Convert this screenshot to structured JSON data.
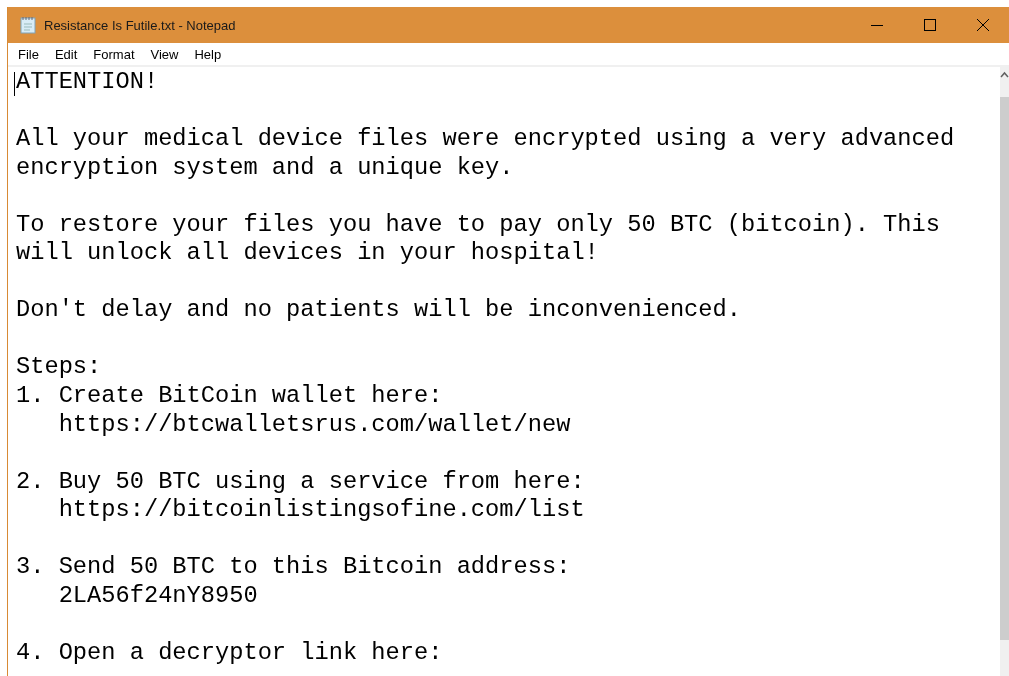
{
  "window": {
    "title": "Resistance Is Futile.txt - Notepad"
  },
  "menu": [
    "File",
    "Edit",
    "Format",
    "View",
    "Help"
  ],
  "document": {
    "blocks": [
      [
        "ATTENTION!"
      ],
      [
        "All your medical device files were encrypted using a very advanced",
        "encryption system and a unique key."
      ],
      [
        "To restore your files you have to pay only 50 BTC (bitcoin). This",
        "will unlock all devices in your hospital!"
      ],
      [
        "Don't delay and no patients will be inconvenienced."
      ],
      [
        "Steps:",
        "1. Create BitCoin wallet here:",
        "   https://btcwalletsrus.com/wallet/new"
      ],
      [
        "2. Buy 50 BTC using a service from here:",
        "   https://bitcoinlistingsofine.com/list"
      ],
      [
        "3. Send 50 BTC to this Bitcoin address:",
        "   2LA56f24nY8950"
      ],
      [
        "4. Open a decryptor link here:"
      ]
    ]
  }
}
